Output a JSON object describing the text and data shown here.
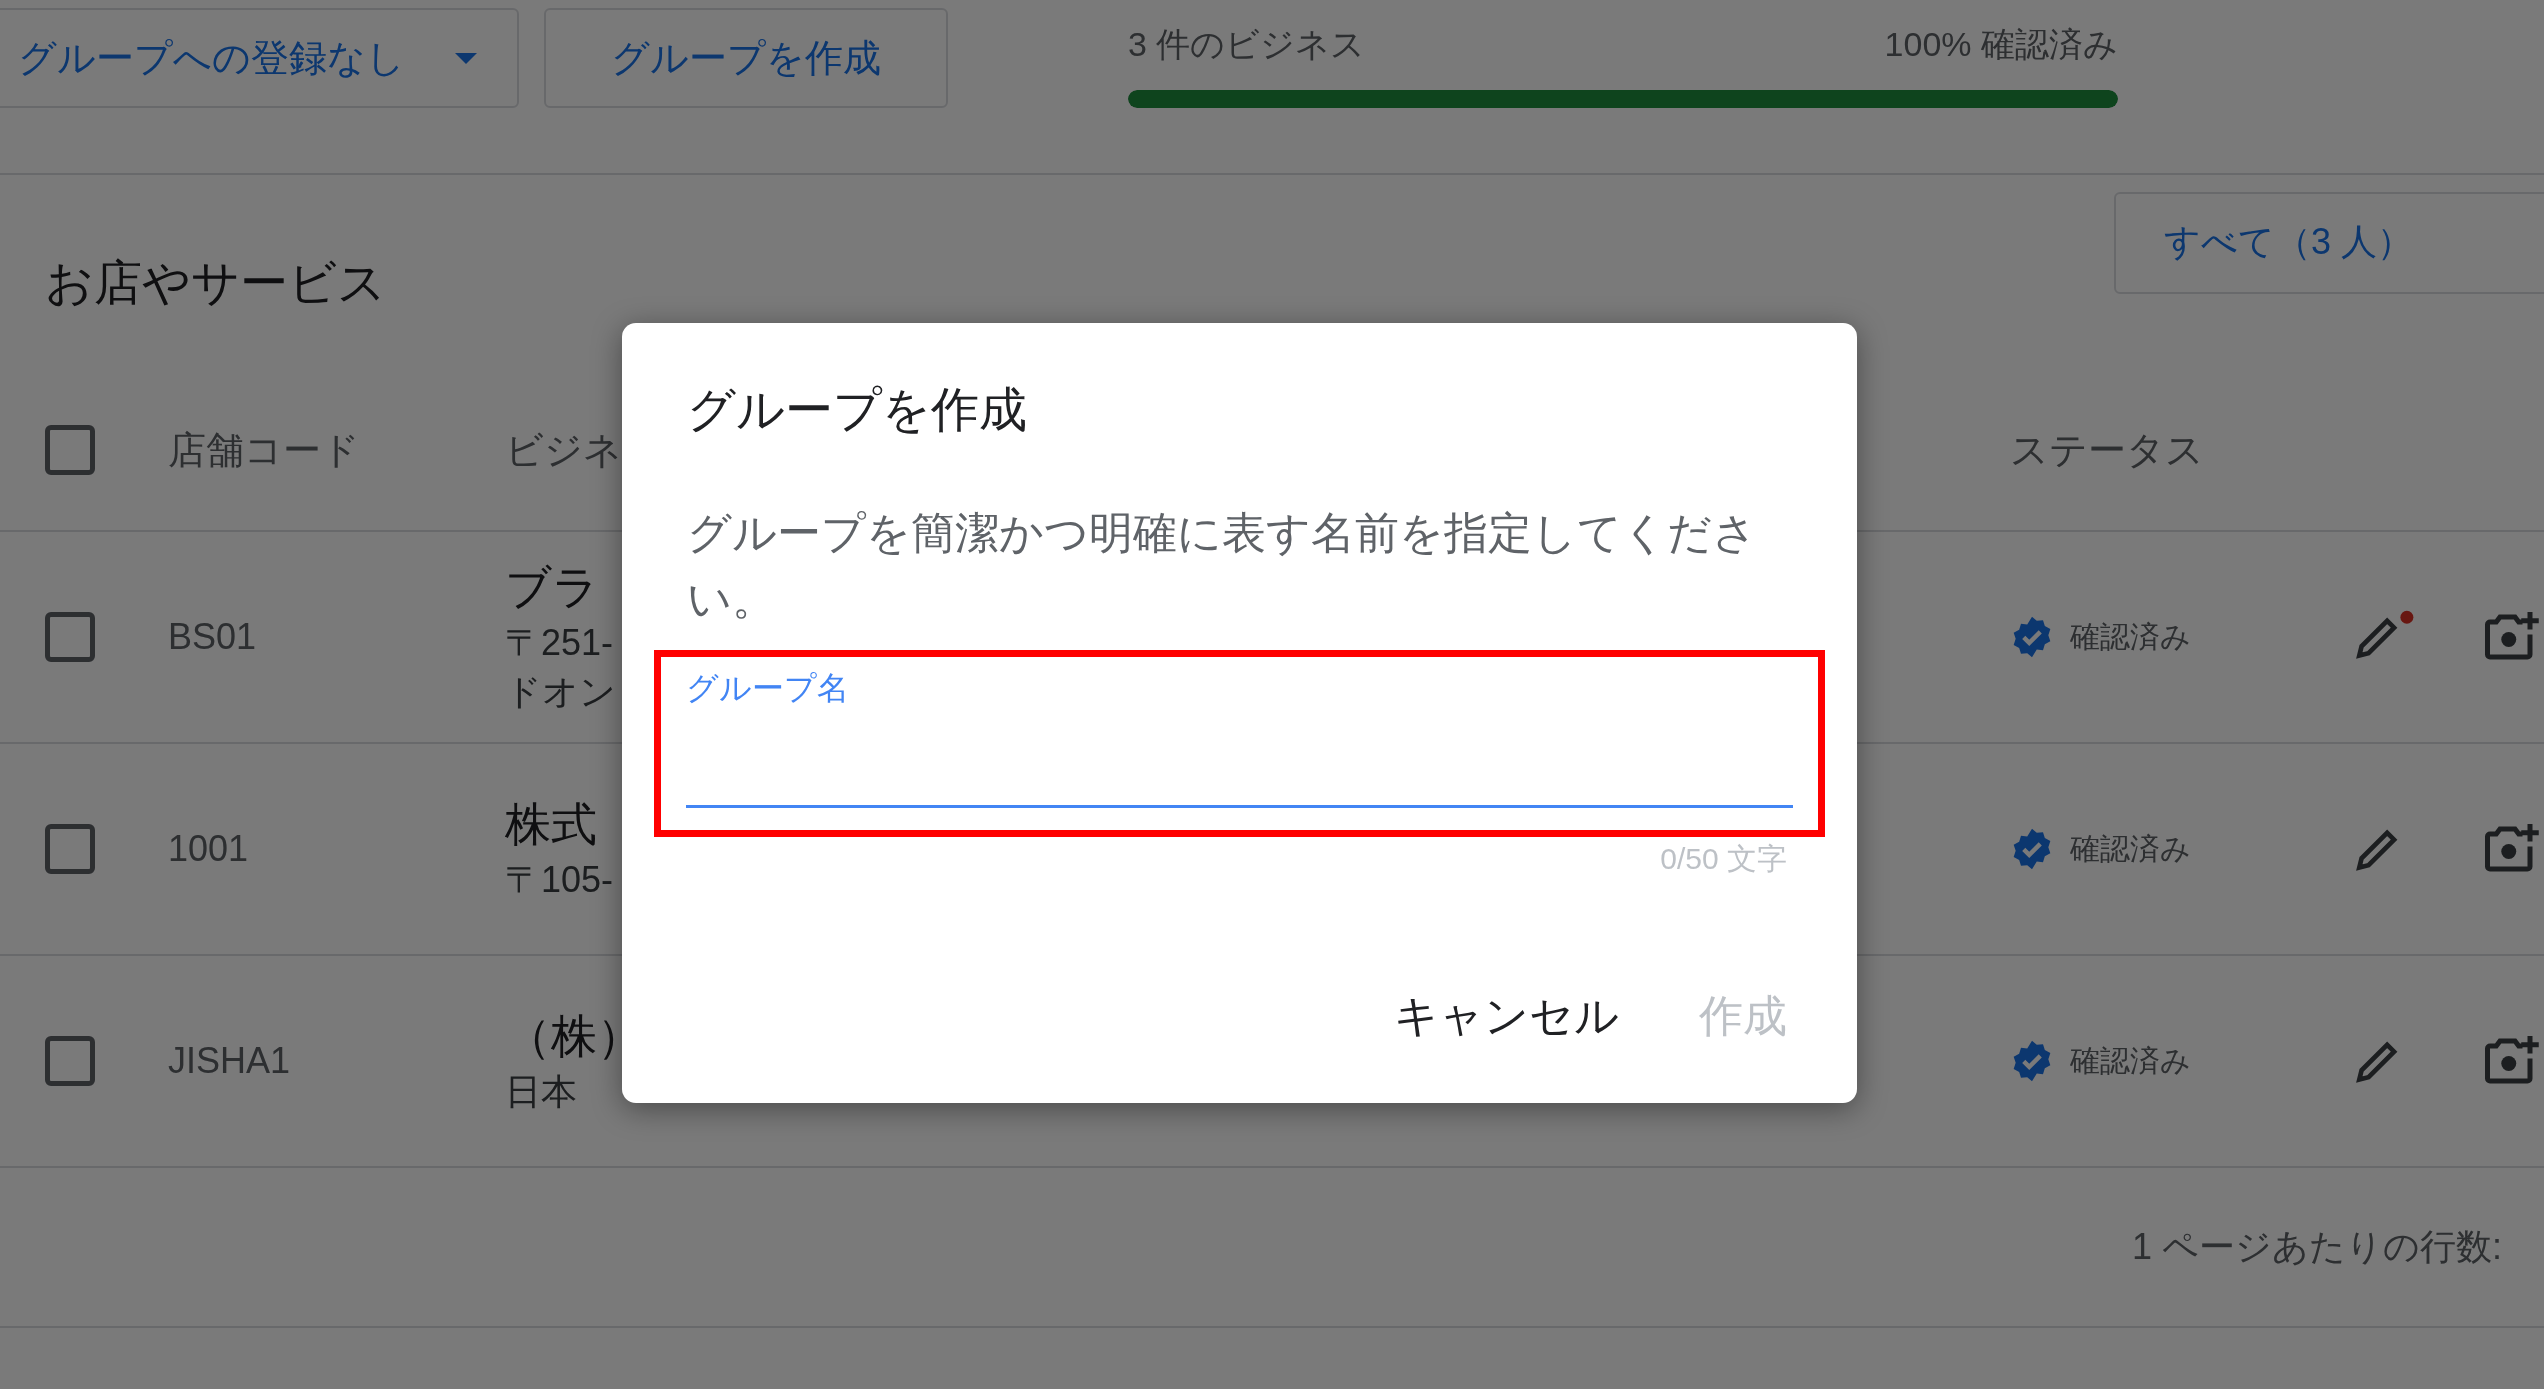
{
  "toolbar": {
    "group_dropdown": "グループへの登録なし",
    "create_group_button": "グループを作成"
  },
  "summary": {
    "count": "3 件のビジネス",
    "verified": "100% 確認済み",
    "level": 1
  },
  "section": {
    "title": "お店やサービス",
    "filter": "すべて（3 人）"
  },
  "table": {
    "columns": [
      "店舗コード",
      "ビジネ",
      "ステータス"
    ],
    "header_checked": false,
    "rows": [
      {
        "checked": false,
        "code": "BS01",
        "business_lines": [
          "ブラ",
          "〒251-",
          "ドオン"
        ],
        "status": "確認済み",
        "edit_badge": true
      },
      {
        "checked": false,
        "code": "1001",
        "business_lines": [
          "株式",
          "〒105-"
        ],
        "status": "確認済み",
        "edit_badge": false
      },
      {
        "checked": false,
        "code": "JISHA1",
        "business_lines": [
          "（株）",
          "日本"
        ],
        "status": "確認済み",
        "edit_badge": false
      }
    ]
  },
  "footer": {
    "rows_per_page": "1 ページあたりの行数:"
  },
  "dialog": {
    "title": "グループを作成",
    "description": "グループを簡潔かつ明確に表す名前を指定してください。",
    "field": {
      "label": "グループ名",
      "counter": "0/50 文字",
      "focused": true,
      "highlighted": true
    },
    "buttons": [
      {
        "label": "キャンセル",
        "disabled": false
      },
      {
        "label": "作成",
        "disabled": true
      }
    ]
  }
}
